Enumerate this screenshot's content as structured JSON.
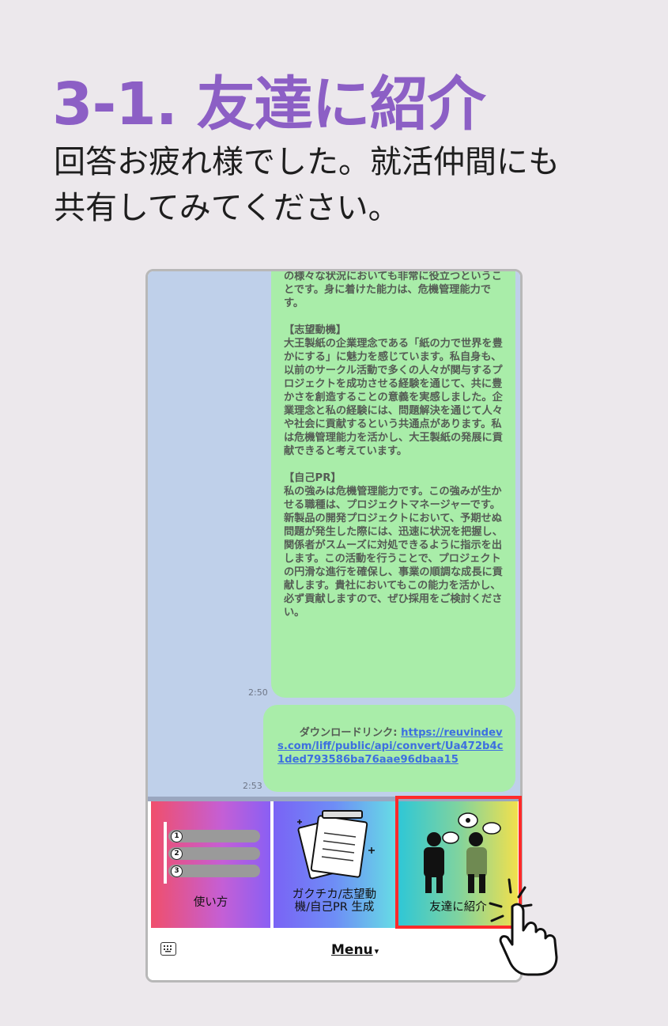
{
  "header": {
    "title": "3-1. 友達に紹介",
    "subtitle": "回答お疲れ様でした。就活仲間にも共有してみてください。"
  },
  "chat": {
    "messages": [
      {
        "text": "の様々な状況においても非常に役立つということです。身に着けた能力は、危機管理能力です。\n\n【志望動機】\n大王製紙の企業理念である「紙の力で世界を豊かにする」に魅力を感じています。私自身も、以前のサークル活動で多くの人々が関与するプロジェクトを成功させる経験を通じて、共に豊かさを創造することの意義を実感しました。企業理念と私の経験には、問題解決を通じて人々や社会に貢献するという共通点があります。私は危機管理能力を活かし、大王製紙の発展に貢献できると考えています。\n\n【自己PR】\n私の強みは危機管理能力です。この強みが生かせる職種は、プロジェクトマネージャーです。新製品の開発プロジェクトにおいて、予期せぬ問題が発生した際には、迅速に状況を把握し、関係者がスムーズに対処できるように指示を出します。この活動を行うことで、プロジェクトの円滑な進行を確保し、事業の順調な成長に貢献します。貴社においてもこの能力を活かし、必ず貢献しますので、ぜひ採用をご検討ください。",
        "time": "2:50"
      },
      {
        "prefix": "ダウンロードリンク: ",
        "link": "https://reuvindevs.com/liff/public/api/convert/Ua472b4c1ded793586ba76aae96dbaa15",
        "time": "2:53"
      }
    ]
  },
  "rich_menu": {
    "items": [
      {
        "label": "使い方",
        "numbers": [
          "1",
          "2",
          "3"
        ]
      },
      {
        "label": "ガクチカ/志望動\n機/自己PR 生成"
      },
      {
        "label": "友達に紹介"
      }
    ],
    "highlight_color": "#ff2a2a"
  },
  "bottom_bar": {
    "keyboard_icon": "keyboard-icon",
    "menu_label": "Menu",
    "menu_arrow": "▾"
  },
  "colors": {
    "title": "#8c5fc5",
    "chat_bg": "#bfd0ea",
    "bubble": "#a9eda9",
    "link": "#3d6fe0"
  }
}
